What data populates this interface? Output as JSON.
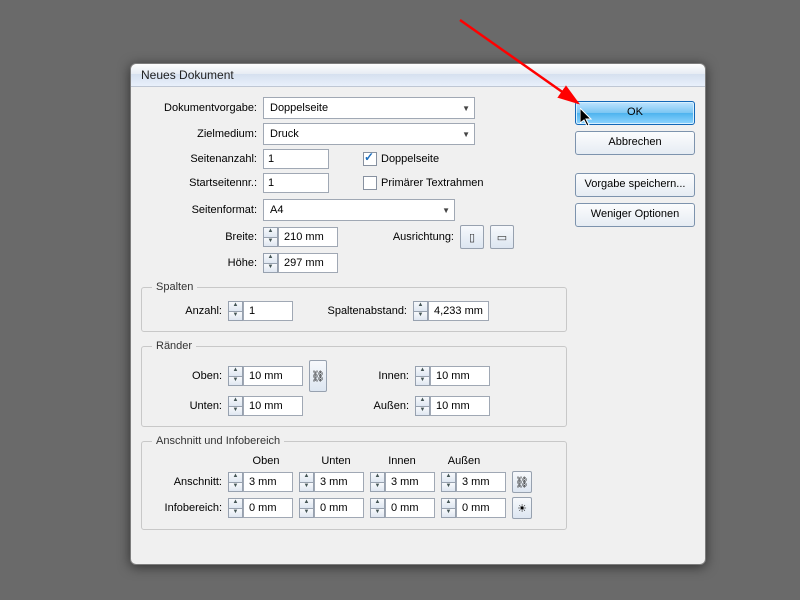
{
  "window": {
    "title": "Neues Dokument"
  },
  "buttons": {
    "ok": "OK",
    "cancel": "Abbrechen",
    "save_preset": "Vorgabe speichern...",
    "fewer_options": "Weniger Optionen"
  },
  "labels": {
    "preset": "Dokumentvorgabe:",
    "intent": "Zielmedium:",
    "page_count": "Seitenanzahl:",
    "start_page": "Startseitennr.:",
    "facing": "Doppelseite",
    "primary_text": "Primärer Textrahmen",
    "page_size": "Seitenformat:",
    "width": "Breite:",
    "height": "Höhe:",
    "orientation": "Ausrichtung:",
    "columns_legend": "Spalten",
    "columns_count": "Anzahl:",
    "gutter": "Spaltenabstand:",
    "margins_legend": "Ränder",
    "top": "Oben:",
    "bottom": "Unten:",
    "inner": "Innen:",
    "outer": "Außen:",
    "bleed_legend": "Anschnitt und Infobereich",
    "col_top": "Oben",
    "col_bottom": "Unten",
    "col_inner": "Innen",
    "col_outer": "Außen",
    "bleed": "Anschnitt:",
    "slug": "Infobereich:"
  },
  "values": {
    "preset": "Doppelseite",
    "intent": "Druck",
    "page_count": "1",
    "start_page": "1",
    "facing_checked": true,
    "primary_text_checked": false,
    "page_size": "A4",
    "width": "210 mm",
    "height": "297 mm",
    "columns_count": "1",
    "gutter": "4,233 mm",
    "margin_top": "10 mm",
    "margin_bottom": "10 mm",
    "margin_inner": "10 mm",
    "margin_outer": "10 mm",
    "bleed_top": "3 mm",
    "bleed_bottom": "3 mm",
    "bleed_inner": "3 mm",
    "bleed_outer": "3 mm",
    "slug_top": "0 mm",
    "slug_bottom": "0 mm",
    "slug_inner": "0 mm",
    "slug_outer": "0 mm"
  },
  "icons": {
    "portrait": "▯",
    "landscape": "▭",
    "link": "⛓",
    "preview": "☀"
  },
  "arrow_color": "#ff0000"
}
